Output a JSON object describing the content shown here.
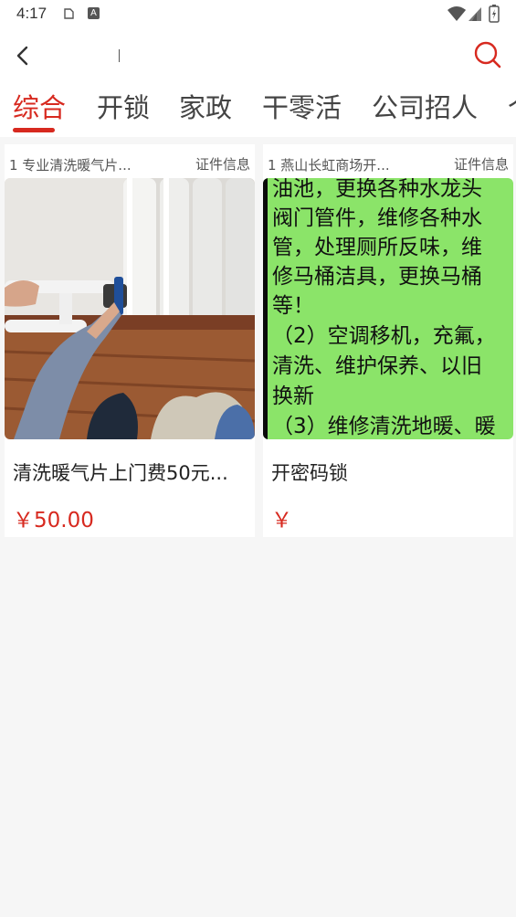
{
  "status_bar": {
    "time": "4:17",
    "notif_icon_a": "clipboard-icon",
    "notif_icon_b_letter": "A",
    "icons": [
      "wifi-icon",
      "signal-icon",
      "battery-icon"
    ]
  },
  "header": {
    "back_icon": "chevron-left-icon",
    "search_value": "",
    "search_icon": "search-icon",
    "accent_color": "#d7291f"
  },
  "tabs": [
    {
      "label": "综合",
      "active": true
    },
    {
      "label": "开锁",
      "active": false
    },
    {
      "label": "家政",
      "active": false
    },
    {
      "label": "干零活",
      "active": false
    },
    {
      "label": "公司招人",
      "active": false
    },
    {
      "label": "个",
      "active": false
    }
  ],
  "products": [
    {
      "rank_title": "1 专业清洗暖气片...",
      "cert_label": "证件信息",
      "name": "清洗暖气片上门费50元...",
      "price": "￥50.00",
      "image_type": "photo-radiator"
    },
    {
      "rank_title": "1 燕山长虹商场开...",
      "cert_label": "证件信息",
      "name": "开密码锁",
      "price": "￥",
      "image_type": "text-poster",
      "image_lines": [
        "油池，更换各种水龙头",
        "阀门管件，维修各种水",
        "管，处理厕所反味，维",
        "修马桶洁具，更换马桶",
        "等！",
        "（2）空调移机，充氟，",
        "清洗、维护保养、以旧",
        "换新",
        "（3）维修清洗地暖、暖"
      ]
    }
  ]
}
